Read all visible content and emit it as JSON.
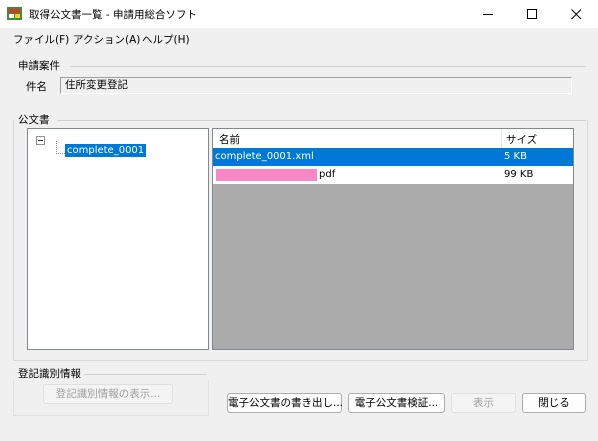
{
  "window": {
    "title": "取得公文書一覧 - 申請用総合ソフト"
  },
  "menu": {
    "items": [
      "ファイル(F)",
      "アクション(A)",
      "ヘルプ(H)"
    ]
  },
  "application_case": {
    "group_title": "申請案件",
    "label": "件名",
    "value": "住所変更登記"
  },
  "documents": {
    "group_title": "公文書",
    "tree": {
      "node_label": "complete_0001"
    },
    "list": {
      "columns": [
        "名前",
        "サイズ"
      ],
      "rows": [
        {
          "name": "complete_0001.xml",
          "size": "5 KB",
          "selected": true
        },
        {
          "name": "pdf",
          "size": "99 KB",
          "selected": false,
          "name_redacted": true
        }
      ]
    }
  },
  "registry_id": {
    "group_title": "登記識別情報",
    "show_button": "登記識別情報の表示..."
  },
  "footer": {
    "export_button": "電子公文書の書き出し...",
    "verify_button": "電子公文書検証...",
    "view_button": "表示",
    "close_button": "閉じる"
  },
  "colors": {
    "selection": "#0078d7",
    "redaction": "#f987c5",
    "list_background": "#ababab"
  }
}
